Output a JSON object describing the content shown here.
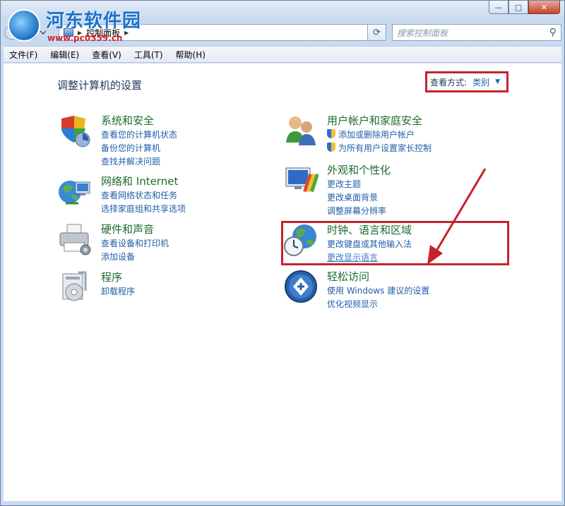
{
  "window": {
    "watermark_title": "河东软件园",
    "watermark_url": "www.pc0359.cn",
    "minimize": "—",
    "maximize": "□",
    "close": "✕"
  },
  "address": {
    "crumb": "控制面板",
    "search_placeholder": "搜索控制面板"
  },
  "menu": [
    "文件(F)",
    "编辑(E)",
    "查看(V)",
    "工具(T)",
    "帮助(H)"
  ],
  "page_title": "调整计算机的设置",
  "view_by": {
    "label": "查看方式:",
    "value": "类别"
  },
  "categories": [
    {
      "title": "系统和安全",
      "links": [
        "查看您的计算机状态",
        "备份您的计算机",
        "查找并解决问题"
      ]
    },
    {
      "title": "网络和 Internet",
      "links": [
        "查看网络状态和任务",
        "选择家庭组和共享选项"
      ]
    },
    {
      "title": "硬件和声音",
      "links": [
        "查看设备和打印机",
        "添加设备"
      ]
    },
    {
      "title": "程序",
      "links": [
        "卸载程序"
      ]
    },
    {
      "title": "用户帐户和家庭安全",
      "links": [
        "添加或删除用户帐户",
        "为所有用户设置家长控制"
      ]
    },
    {
      "title": "外观和个性化",
      "links": [
        "更改主题",
        "更改桌面背景",
        "调整屏幕分辨率"
      ]
    },
    {
      "title": "时钟、语言和区域",
      "links": [
        "更改键盘或其他输入法",
        "更改显示语言"
      ]
    },
    {
      "title": "轻松访问",
      "links": [
        "使用 Windows 建议的设置",
        "优化视频显示"
      ]
    }
  ],
  "colors": {
    "category_title": "#1d6b2f",
    "link": "#1f5ea8",
    "highlight": "#c4232c"
  }
}
